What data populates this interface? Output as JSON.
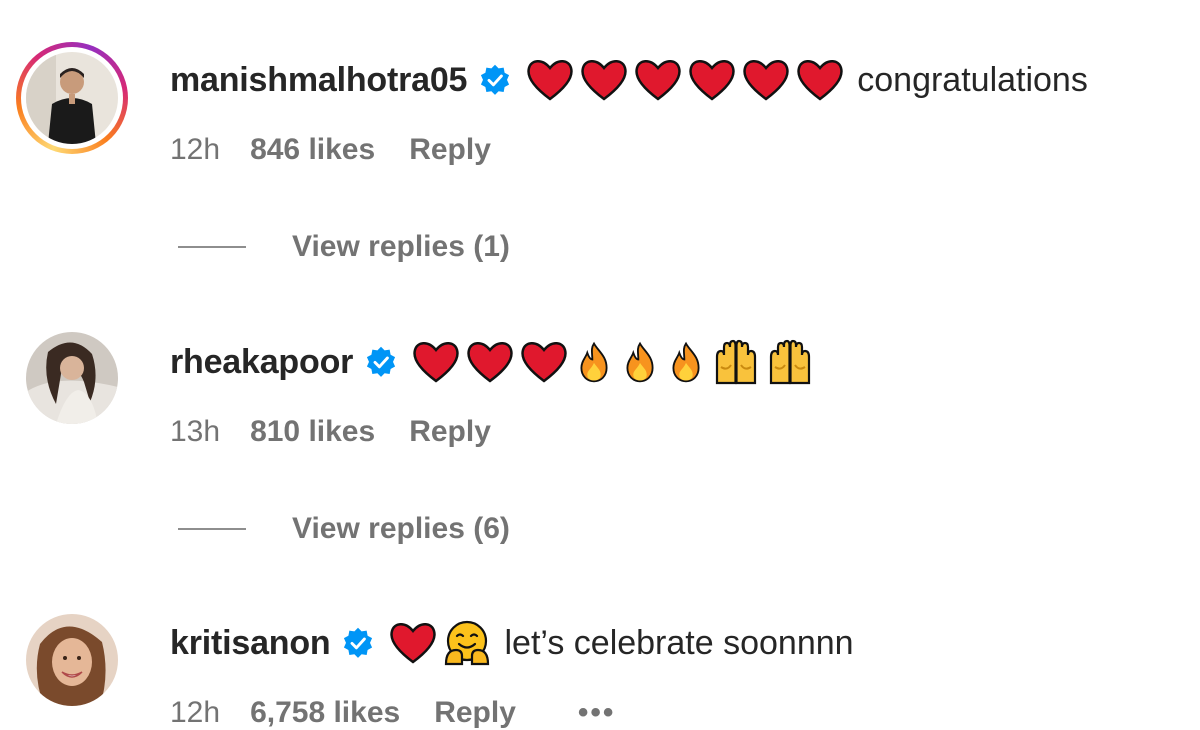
{
  "comments": [
    {
      "username": "manishmalhotra05",
      "verified": true,
      "has_story_ring": true,
      "emojis": [
        "red-heart",
        "red-heart",
        "red-heart",
        "red-heart",
        "red-heart",
        "red-heart"
      ],
      "text": "congratulations",
      "time": "12h",
      "likes": "846 likes",
      "reply_label": "Reply",
      "view_replies": "View replies (1)"
    },
    {
      "username": "rheakapoor",
      "verified": true,
      "has_story_ring": false,
      "emojis": [
        "red-heart",
        "red-heart",
        "red-heart",
        "fire",
        "fire",
        "fire",
        "raising-hands",
        "raising-hands"
      ],
      "text": "",
      "time": "13h",
      "likes": "810 likes",
      "reply_label": "Reply",
      "view_replies": "View replies (6)"
    },
    {
      "username": "kritisanon",
      "verified": true,
      "has_story_ring": false,
      "emojis": [
        "red-heart",
        "hugging-face"
      ],
      "text": "let’s celebrate soonnnn",
      "time": "12h",
      "likes": "6,758 likes",
      "reply_label": "Reply",
      "more_label": "•••"
    }
  ],
  "colors": {
    "text_primary": "#262626",
    "text_secondary": "#737373",
    "verified_blue": "#0095f6",
    "heart_red": "#e0182d"
  }
}
